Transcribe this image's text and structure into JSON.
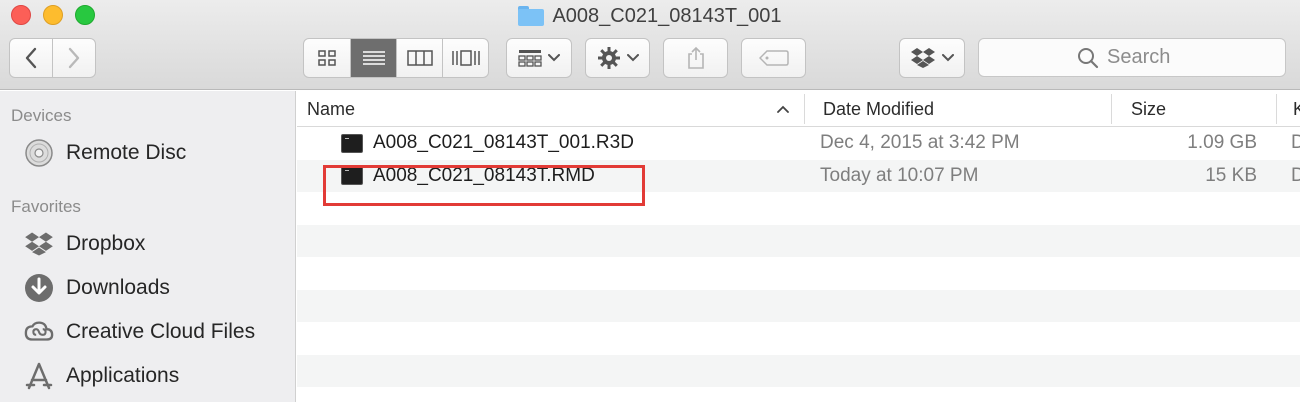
{
  "window": {
    "title": "A008_C021_08143T_001"
  },
  "toolbar": {
    "back_icon": "chevron-left-icon",
    "forward_icon": "chevron-right-icon",
    "view_modes": [
      "icon-view",
      "list-view",
      "column-view",
      "cover-flow-view"
    ],
    "active_view": "list-view",
    "arrange_icon": "arrange-grid-icon",
    "action_icon": "gear-icon",
    "share_icon": "share-icon",
    "tag_icon": "tag-icon",
    "dropbox_icon": "dropbox-icon"
  },
  "search": {
    "placeholder": "Search"
  },
  "sidebar": {
    "sections": [
      {
        "title": "Devices",
        "items": [
          {
            "label": "Remote Disc",
            "icon": "disc-icon"
          }
        ]
      },
      {
        "title": "Favorites",
        "items": [
          {
            "label": "Dropbox",
            "icon": "dropbox-icon"
          },
          {
            "label": "Downloads",
            "icon": "downloads-icon"
          },
          {
            "label": "Creative Cloud Files",
            "icon": "creative-cloud-icon"
          },
          {
            "label": "Applications",
            "icon": "applications-icon"
          }
        ]
      }
    ]
  },
  "list": {
    "columns": {
      "name": "Name",
      "date": "Date Modified",
      "size": "Size",
      "kind": "K"
    },
    "rows": [
      {
        "name": "A008_C021_08143T_001.R3D",
        "date": "Dec 4, 2015 at 3:42 PM",
        "size": "1.09 GB",
        "kind": "D"
      },
      {
        "name": "A008_C021_08143T.RMD",
        "date": "Today at 10:07 PM",
        "size": "15 KB",
        "kind": "D"
      }
    ]
  },
  "colors": {
    "highlight": "#e23b36",
    "folder": "#7cc2f6"
  }
}
